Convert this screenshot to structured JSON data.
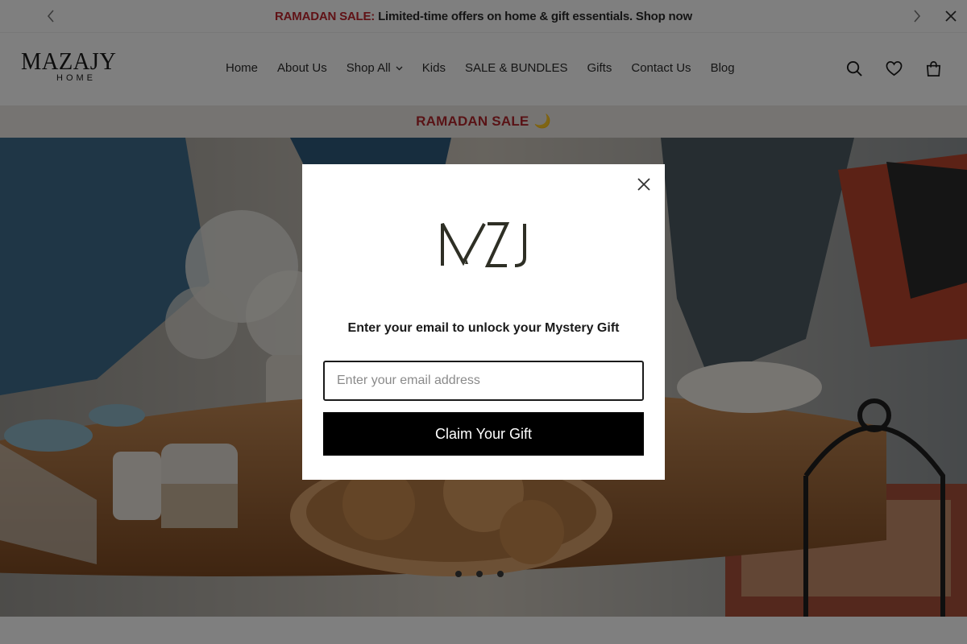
{
  "announcement": {
    "sale_label": "RAMADAN SALE:",
    "message": "Limited-time offers on home & gift essentials. Shop now"
  },
  "header": {
    "logo_word": "MAZAJY",
    "logo_sub": "HOME",
    "nav": [
      {
        "label": "Home"
      },
      {
        "label": "About Us"
      },
      {
        "label": "Shop All"
      },
      {
        "label": "Kids"
      },
      {
        "label": "SALE & BUNDLES"
      },
      {
        "label": "Gifts"
      },
      {
        "label": "Contact Us"
      },
      {
        "label": "Blog"
      }
    ]
  },
  "band": {
    "text": "RAMADAN SALE",
    "emoji": "🌙"
  },
  "modal": {
    "headline": "Enter your email to unlock your Mystery Gift",
    "email_placeholder": "Enter your email address",
    "email_value": "",
    "button_label": "Claim Your Gift"
  },
  "colors": {
    "sale_red": "#c0242c",
    "band_bg": "#ece9e4",
    "button_bg": "#000000"
  },
  "icons": [
    "chevron-left-icon",
    "chevron-right-icon",
    "close-icon",
    "search-icon",
    "heart-icon",
    "bag-icon",
    "chevron-down-icon"
  ]
}
